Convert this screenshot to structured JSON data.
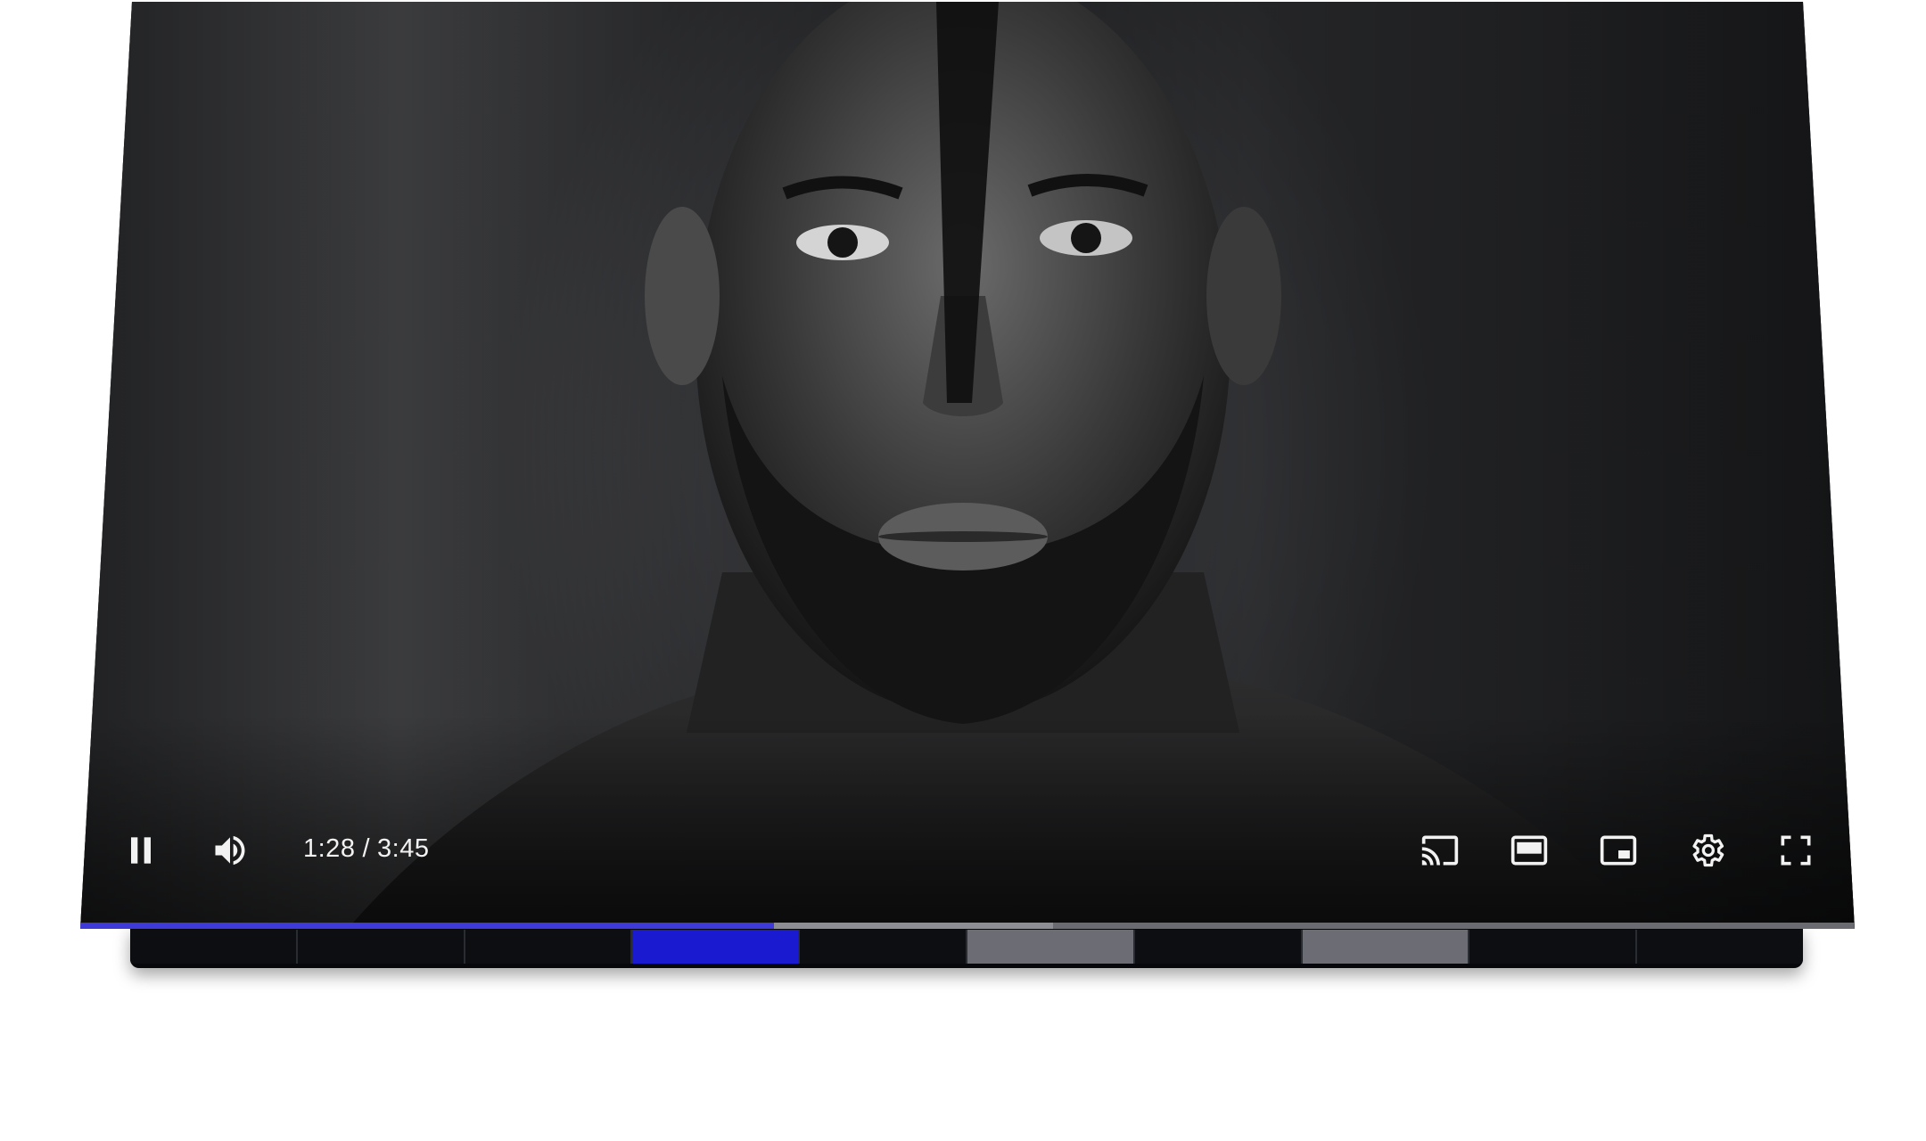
{
  "player": {
    "time": {
      "current": "1:28",
      "separator": "/",
      "duration": "3:45"
    },
    "progress": {
      "played_fraction": 0.391,
      "buffered_fraction": 0.548
    },
    "colors": {
      "accent": "#3d3ad9",
      "control_icon": "#f2f2f2"
    },
    "controls": {
      "left": [
        "pause-icon",
        "volume-icon"
      ],
      "right": [
        "cast-icon",
        "theater-mode-icon",
        "miniplayer-icon",
        "settings-gear-icon",
        "fullscreen-icon"
      ]
    },
    "thumbnail_strip": {
      "tones": [
        "#0d0e12",
        "#0d0e12",
        "#0d0e12",
        "#1a1bd0",
        "#0d0e12",
        "#6b6c74",
        "#0d0e12",
        "#6b6c74",
        "#0d0e12",
        "#0d0e12"
      ]
    }
  }
}
